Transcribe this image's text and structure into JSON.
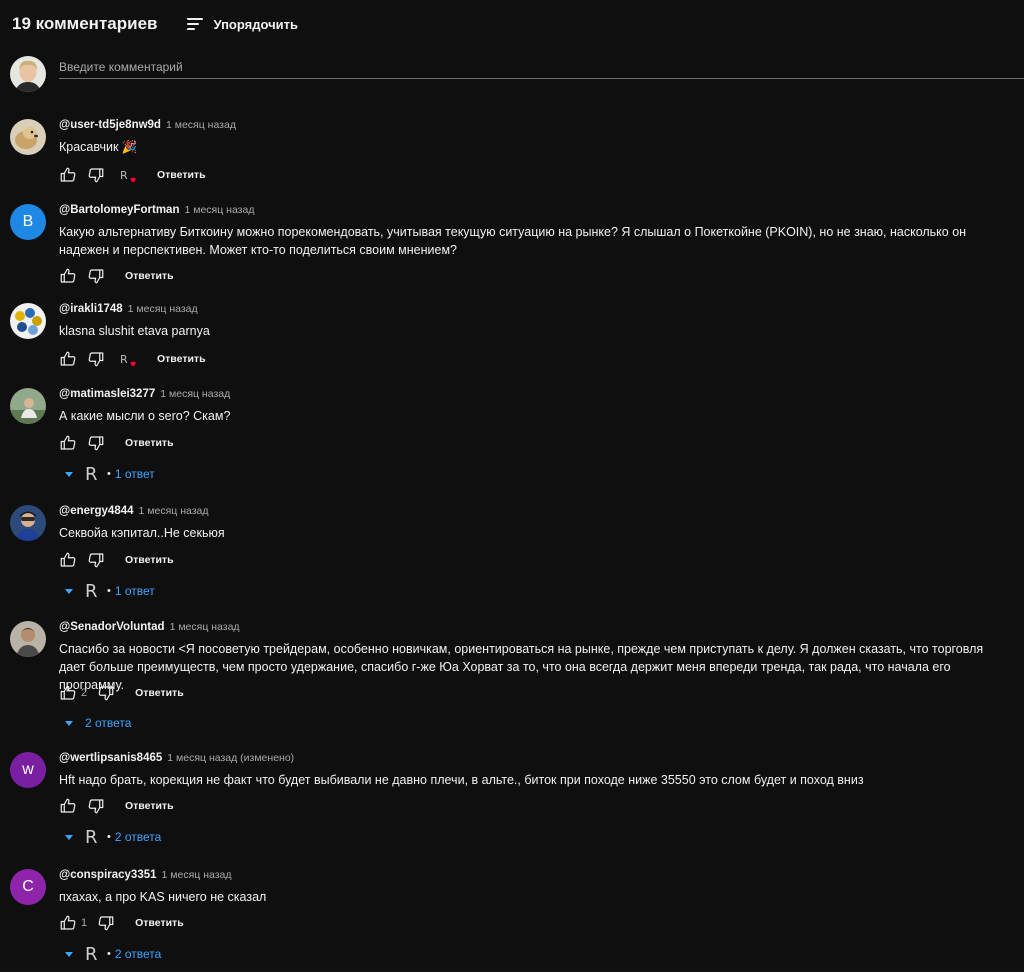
{
  "header": {
    "count": "19 комментариев",
    "sort_label": "Упорядочить",
    "sort_icon": "sort-icon"
  },
  "composer": {
    "placeholder": "Введите комментарий"
  },
  "reply_label": "Ответить",
  "comments": [
    {
      "author": "@user-td5je8nw9d",
      "time": "1 месяц назад",
      "text": "Красавчик 🎉",
      "heart": true
    },
    {
      "author": "@BartolomeyFortman",
      "time": "1 месяц назад",
      "avatar_letter": "B",
      "avatar_color": "#1e88e5",
      "text": "Какую альтернативу Биткоину можно порекомендовать, учитывая текущую ситуацию на рынке? Я слышал о Покеткойне (PKOIN), но не знаю, насколько он надежен и перспективен. Может кто-то поделиться своим мнением?"
    },
    {
      "author": "@irakli1748",
      "time": "1 месяц назад",
      "text": "klasna slushit etava parnya",
      "heart": true
    },
    {
      "author": "@matimaslei3277",
      "time": "1 месяц назад",
      "text": "А какие мысли о sero? Скам?",
      "replies_logo": "R",
      "replies_dot": "•",
      "replies": "1 ответ"
    },
    {
      "author": "@energy4844",
      "time": "1 месяц назад",
      "text": "Секвойа кэпитал..Не секьюя",
      "replies_logo": "R",
      "replies_dot": "•",
      "replies": "1 ответ"
    },
    {
      "author": "@SenadorVoluntad",
      "time": "1 месяц назад",
      "text": "Спасибо за новости <Я посоветую трейдерам, особенно новичкам, ориентироваться на рынке, прежде чем приступать к делу.  Я должен сказать, что торговля дает больше преимуществ, чем просто удержание, спасибо г-же Юа Хорват за то, что она всегда держит меня впереди тренда, так рада, что начала его программу.",
      "likes": "2",
      "replies": "2 ответа"
    },
    {
      "author": "@wertlipsanis8465",
      "time": "1 месяц назад (изменено)",
      "avatar_letter": "w",
      "avatar_color": "#7b1fa2",
      "text": "Hft  надо брать, корекция не факт что будет   выбивали не давно плечи, в альте., биток при походе ниже 35550 это слом будет и поход вниз",
      "replies_logo": "R",
      "replies_dot": "•",
      "replies": "2 ответа"
    },
    {
      "author": "@conspiracy3351",
      "time": "1 месяц назад",
      "avatar_letter": "C",
      "avatar_color": "#8e24aa",
      "text": "пхахах, а про KAS ничего не сказал",
      "likes": "1",
      "replies_logo": "R",
      "replies_dot": "•",
      "replies": "2 ответа"
    }
  ]
}
